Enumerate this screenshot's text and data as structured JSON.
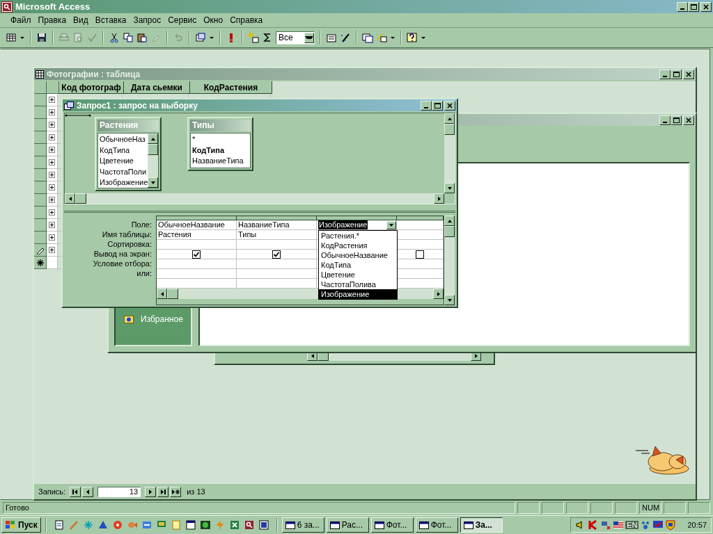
{
  "window": {
    "title": "Microsoft Access"
  },
  "menu": [
    "Файл",
    "Правка",
    "Вид",
    "Вставка",
    "Запрос",
    "Сервис",
    "Окно",
    "Справка"
  ],
  "toolbar": {
    "filter": "Все"
  },
  "table_window": {
    "title": "Фотографии : таблица",
    "columns": [
      "Код фотограф",
      "Дата сьемки",
      "КодРастения"
    ],
    "rows": [
      {
        "kind": "record"
      },
      {
        "kind": "record"
      },
      {
        "kind": "record"
      },
      {
        "kind": "record"
      },
      {
        "kind": "record"
      },
      {
        "kind": "record"
      },
      {
        "kind": "record"
      },
      {
        "kind": "record"
      },
      {
        "kind": "record"
      },
      {
        "kind": "record"
      },
      {
        "kind": "record"
      },
      {
        "kind": "record"
      },
      {
        "kind": "editing"
      },
      {
        "kind": "new"
      }
    ],
    "navigation": {
      "label": "Запись:",
      "current": "13",
      "total": "из 13"
    }
  },
  "database_window": {
    "groups": [
      "Избранное"
    ]
  },
  "query_window": {
    "title": "Запрос1 : запрос на выборку",
    "tables": [
      {
        "name": "Растения",
        "scroll": true,
        "fields": [
          {
            "name": "ОбычноеНаз",
            "key": false
          },
          {
            "name": "КодТипа",
            "key": false
          },
          {
            "name": "Цветение",
            "key": false
          },
          {
            "name": "ЧастотаПоли",
            "key": false
          },
          {
            "name": "Изображение",
            "key": false
          }
        ]
      },
      {
        "name": "Типы",
        "scroll": false,
        "fields": [
          {
            "name": "*",
            "key": false
          },
          {
            "name": "КодТипа",
            "key": true
          },
          {
            "name": "НазваниеТипа",
            "key": false
          }
        ]
      }
    ],
    "row_labels": [
      "Поле:",
      "Имя таблицы:",
      "Сортировка:",
      "Вывод на экран:",
      "Условие отбора:",
      "или:"
    ],
    "columns": [
      {
        "kind": "field",
        "field": "ОбычноеНазвание",
        "table": "Растения",
        "show": true
      },
      {
        "kind": "field",
        "field": "НазваниеТипа",
        "table": "Типы",
        "show": true
      },
      {
        "kind": "editing",
        "field": "Изображение"
      },
      {
        "kind": "empty",
        "show": false
      }
    ],
    "dropdown": [
      {
        "label": "Растения.*",
        "selected": false
      },
      {
        "label": "КодРастения",
        "selected": false
      },
      {
        "label": "ОбычноеНазвание",
        "selected": false
      },
      {
        "label": "КодТипа",
        "selected": false
      },
      {
        "label": "Цветение",
        "selected": false
      },
      {
        "label": "ЧастотаПолива",
        "selected": false
      },
      {
        "label": "Изображение",
        "selected": true
      }
    ]
  },
  "status_bar": {
    "text": "Готово",
    "num": "NUM"
  },
  "taskbar": {
    "start": "Пуск",
    "tasks": [
      {
        "label": "6 за...",
        "selected": false
      },
      {
        "label": "Рас...",
        "selected": false
      },
      {
        "label": "Фот...",
        "selected": false
      },
      {
        "label": "Фот...",
        "selected": false
      },
      {
        "label": "За...",
        "selected": true
      }
    ],
    "language": "EN",
    "clock": "20:57"
  }
}
